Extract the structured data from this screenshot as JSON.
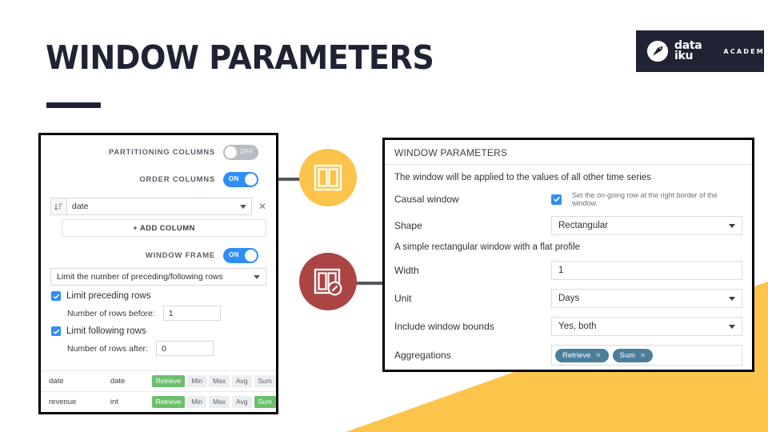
{
  "slide": {
    "title": "WINDOW PARAMETERS"
  },
  "logo": {
    "wordmark_line1": "data",
    "wordmark_line2": "iku",
    "academy": "ACADEMY",
    "brand_dark": "#1f2333"
  },
  "badges": [
    {
      "name": "window-panes",
      "color": "#fcc44a"
    },
    {
      "name": "window-panes-time",
      "color": "#ab4543"
    }
  ],
  "left_panel": {
    "partitioning_columns": {
      "label": "PARTITIONING COLUMNS",
      "state": "OFF"
    },
    "order_columns": {
      "label": "ORDER COLUMNS",
      "state": "ON"
    },
    "order_column_value": "date",
    "add_column_label": "+ ADD COLUMN",
    "window_frame": {
      "label": "WINDOW FRAME",
      "state": "ON"
    },
    "frame_mode": "Limit the number of preceding/following rows",
    "limit_preceding": {
      "label": "Limit preceding rows",
      "checked": true
    },
    "rows_before": {
      "label": "Number of rows before:",
      "value": "1"
    },
    "limit_following": {
      "label": "Limit following rows",
      "checked": true
    },
    "rows_after": {
      "label": "Number of rows after:",
      "value": "0"
    },
    "table": {
      "rows": [
        {
          "column": "date",
          "type": "date",
          "aggregations": [
            {
              "label": "Retrieve",
              "active": true
            },
            {
              "label": "Min",
              "active": false
            },
            {
              "label": "Max",
              "active": false
            },
            {
              "label": "Avg",
              "active": false
            },
            {
              "label": "Sum",
              "active": false
            }
          ]
        },
        {
          "column": "revenue",
          "type": "int",
          "aggregations": [
            {
              "label": "Retrieve",
              "active": true
            },
            {
              "label": "Min",
              "active": false
            },
            {
              "label": "Max",
              "active": false
            },
            {
              "label": "Avg",
              "active": false
            },
            {
              "label": "Sum",
              "active": true
            }
          ]
        }
      ]
    }
  },
  "right_panel": {
    "header": "WINDOW PARAMETERS",
    "intro": "The window will be applied to the values of all other time series",
    "causal_window": {
      "label": "Causal window",
      "checked": true,
      "hint": "Set the on-going row at the right border of the window."
    },
    "shape": {
      "label": "Shape",
      "value": "Rectangular",
      "description": "A simple rectangular window with a flat profile"
    },
    "width": {
      "label": "Width",
      "value": "1"
    },
    "unit": {
      "label": "Unit",
      "value": "Days"
    },
    "include_bounds": {
      "label": "Include window bounds",
      "value": "Yes, both"
    },
    "aggregations": {
      "label": "Aggregations",
      "chips": [
        "Retrieve",
        "Sum"
      ],
      "chip_color": "#4a7e9b"
    }
  },
  "decor": {
    "wedge_color": "#fcc44a"
  }
}
